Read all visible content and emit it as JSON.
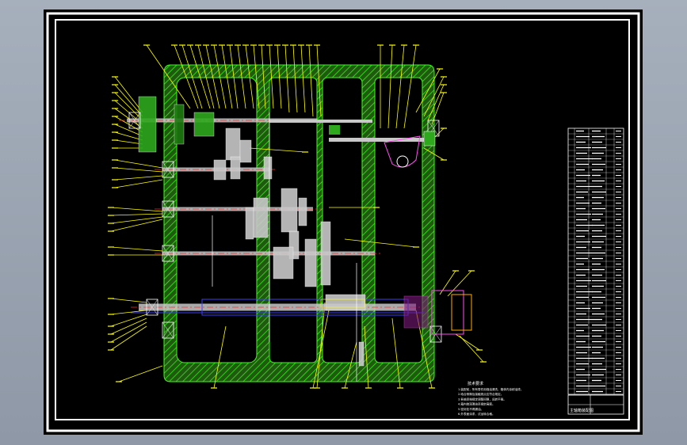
{
  "drawing": {
    "tech_requirements_title": "技术要求",
    "tech_requirements": [
      "1.装配前，所有零件用煤油清洗，箱体内涂耐油漆。",
      "2.啮合侧隙及接触斑点应符合规定。",
      "3.各轴承按规定调整间隙，运转平稳。",
      "4.箱内装润滑油至规定高度。",
      "5.密封处不得漏油。",
      "6.外表面涂漆，试运转合格。"
    ],
    "title_block_text": "主轴箱装配图"
  },
  "colors": {
    "background": "#000000",
    "frame": "#ffffff",
    "housing_fill": "#2e7d18",
    "housing_line": "#39ff14",
    "leader": "#ffff00",
    "shaft": "#c8c8c8",
    "centerline": "#ff2b2b",
    "axis": "#3b3bff",
    "part": "#ff4df0",
    "bearing": "#ffffff"
  }
}
